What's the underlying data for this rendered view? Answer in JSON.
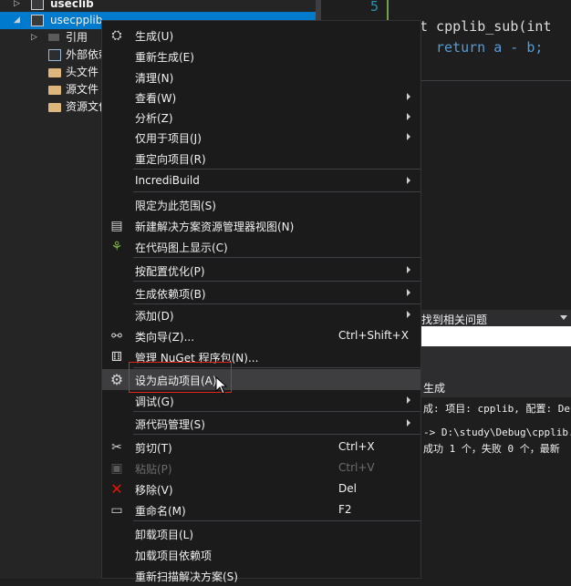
{
  "solution": {
    "items": [
      {
        "label": "useclib",
        "expander": "▷"
      },
      {
        "label": "usecpplib",
        "expander": "◢"
      },
      {
        "label": "引用",
        "expander": "▷"
      },
      {
        "label": "外部依赖"
      },
      {
        "label": "头文件"
      },
      {
        "label": "源文件"
      },
      {
        "label": "资源文件"
      }
    ]
  },
  "editor": {
    "line_number": "5",
    "line1": "t cpplib_sub(int",
    "line2": "return a - b;"
  },
  "find_bar": {
    "text": "找到相关问题"
  },
  "output": {
    "title": "生成",
    "lines": [
      "成: 项目: cpplib, 配置: Deb",
      "",
      "-> D:\\study\\Debug\\cpplib.li",
      "成功 1 个，失败 0 个，最新"
    ]
  },
  "context_menu": {
    "items": [
      {
        "label": "生成(U)",
        "icon": "build-icon"
      },
      {
        "label": "重新生成(E)"
      },
      {
        "label": "清理(N)"
      },
      {
        "label": "查看(W)",
        "submenu": true
      },
      {
        "label": "分析(Z)",
        "submenu": true
      },
      {
        "label": "仅用于项目(J)",
        "submenu": true
      },
      {
        "label": "重定向项目(R)"
      },
      {
        "label": "IncrediBuild",
        "submenu": true
      },
      {
        "label": "限定为此范围(S)"
      },
      {
        "label": "新建解决方案资源管理器视图(N)",
        "icon": "new-view-icon"
      },
      {
        "label": "在代码图上显示(C)",
        "icon": "code-map-icon"
      },
      {
        "label": "按配置优化(P)",
        "submenu": true
      },
      {
        "label": "生成依赖项(B)",
        "submenu": true
      },
      {
        "label": "添加(D)",
        "submenu": true
      },
      {
        "label": "类向导(Z)...",
        "shortcut": "Ctrl+Shift+X",
        "icon": "class-wizard-icon"
      },
      {
        "label": "管理 NuGet 程序包(N)...",
        "icon": "nuget-icon"
      },
      {
        "label": "设为启动项目(A)",
        "icon": "gear-icon"
      },
      {
        "label": "调试(G)",
        "submenu": true
      },
      {
        "label": "源代码管理(S)",
        "submenu": true
      },
      {
        "label": "剪切(T)",
        "shortcut": "Ctrl+X",
        "icon": "cut-icon"
      },
      {
        "label": "粘贴(P)",
        "shortcut": "Ctrl+V",
        "icon": "paste-icon",
        "disabled": true
      },
      {
        "label": "移除(V)",
        "shortcut": "Del",
        "icon": "remove-icon"
      },
      {
        "label": "重命名(M)",
        "shortcut": "F2",
        "icon": "rename-icon"
      },
      {
        "label": "卸载项目(L)"
      },
      {
        "label": "加载项目依赖项"
      },
      {
        "label": "重新扫描解决方案(S)"
      }
    ]
  },
  "colors": {
    "selection": "#007acc",
    "highlight_box": "#e2231a",
    "remove_icon": "#e51400"
  }
}
